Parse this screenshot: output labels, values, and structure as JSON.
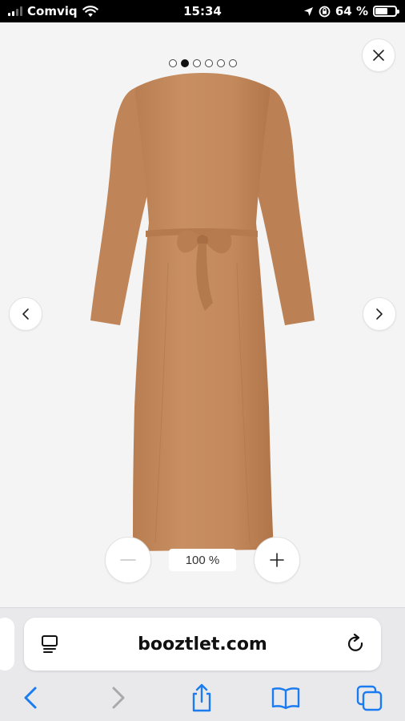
{
  "status_bar": {
    "carrier": "Comviq",
    "time": "15:34",
    "battery_percent": "64 %",
    "battery_level": 0.64
  },
  "gallery": {
    "image_count": 6,
    "active_index": 1,
    "zoom_level": "100 %",
    "product_color": "#c48a5c"
  },
  "browser": {
    "url": "booztlet.com"
  },
  "icons": {
    "close": "close-icon",
    "prev": "chevron-left-icon",
    "next": "chevron-right-icon",
    "zoom_out": "minus-icon",
    "zoom_in": "plus-icon",
    "reader": "reader-mode-icon",
    "reload": "reload-icon",
    "back": "back-icon",
    "forward": "forward-icon",
    "share": "share-icon",
    "bookmarks": "bookmarks-icon",
    "tabs": "tabs-icon"
  },
  "colors": {
    "accent": "#1a7cf0",
    "disabled": "#a8a8ad"
  }
}
